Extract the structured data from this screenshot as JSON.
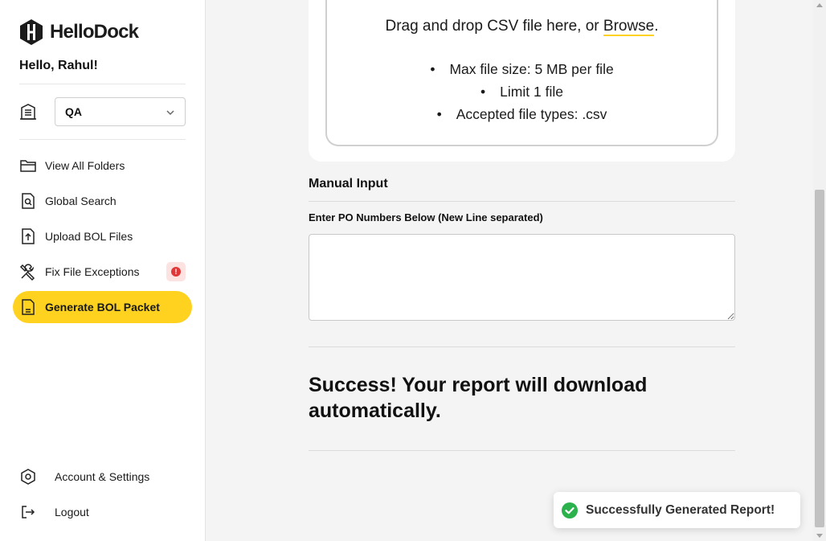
{
  "app": {
    "name": "HelloDock"
  },
  "sidebar": {
    "greeting": "Hello, Rahul!",
    "workspace": {
      "selected": "QA",
      "icon": "building-icon"
    },
    "items": [
      {
        "label": "View All Folders",
        "icon": "folder-icon"
      },
      {
        "label": "Global Search",
        "icon": "file-search-icon"
      },
      {
        "label": "Upload BOL Files",
        "icon": "file-upload-icon"
      },
      {
        "label": "Fix File Exceptions",
        "icon": "tools-icon",
        "badge": "!"
      },
      {
        "label": "Generate BOL Packet",
        "icon": "document-icon",
        "active": true
      }
    ],
    "bottom": [
      {
        "label": "Account & Settings",
        "icon": "settings-hex-icon"
      },
      {
        "label": "Logout",
        "icon": "logout-icon"
      }
    ]
  },
  "upload": {
    "drop_text": "Drag and drop CSV file here, or",
    "browse_label": "Browse",
    "drop_suffix": ".",
    "rules": [
      "Max file size: 5 MB per file",
      "Limit 1 file",
      "Accepted file types: .csv"
    ]
  },
  "manual": {
    "title": "Manual Input",
    "field_label": "Enter PO Numbers Below (New Line separated)",
    "value": ""
  },
  "result": {
    "message": "Success! Your report will download automatically."
  },
  "toast": {
    "text": "Successfully Generated Report!",
    "icon": "check-circle-icon"
  },
  "colors": {
    "accent": "#ffd21f",
    "success": "#2bb24c",
    "danger": "#e03838"
  }
}
